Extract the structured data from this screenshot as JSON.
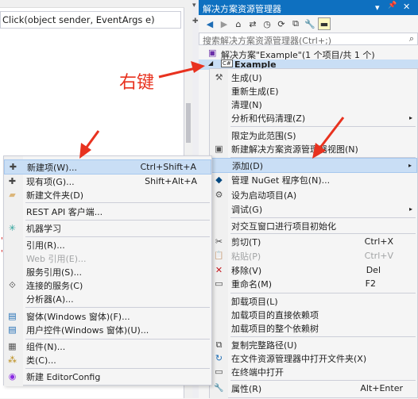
{
  "editor": {
    "signature": "Click(object sender, EventArgs e)",
    "gutter_chars": [
      "'",
      "'",
      "'"
    ]
  },
  "annotation": {
    "text": "右键",
    "color": "#e8321f"
  },
  "solution_explorer": {
    "title": "解决方案资源管理器",
    "title_icons": {
      "dropdown": "▾",
      "pin": "📌",
      "close": "✕"
    },
    "toolbar": {
      "back": "◀",
      "forward": "▶",
      "home": "⌂",
      "sync": "⇄",
      "history": "◷",
      "refresh": "⟳",
      "collapse": "⧉",
      "properties": "🔧",
      "preview": "▬"
    },
    "search_placeholder": "搜索解决方案资源管理器(Ctrl+;)",
    "search_icon": "⌕",
    "solution_node": "解决方案\"Example\"(1 个项目/共 1 个)",
    "project_node": "Example",
    "tree_icons": {
      "solution": "▣",
      "project": "C#"
    }
  },
  "context_menu": {
    "items": [
      {
        "label": "生成(U)",
        "icon": "⚒"
      },
      {
        "label": "重新生成(E)"
      },
      {
        "label": "清理(N)"
      },
      {
        "label": "分析和代码清理(Z)",
        "submenu": "▸"
      },
      {
        "label": "限定为此范围(S)"
      },
      {
        "label": "新建解决方案资源管理器视图(N)",
        "icon": "▣"
      },
      {
        "label": "添加(D)",
        "submenu": "▸",
        "highlighted": true
      },
      {
        "label": "管理 NuGet 程序包(N)...",
        "icon": "◆"
      },
      {
        "label": "设为启动项目(A)",
        "icon": "⚙"
      },
      {
        "label": "调试(G)",
        "submenu": "▸"
      },
      {
        "label": "对交互窗口进行项目初始化"
      },
      {
        "label": "剪切(T)",
        "icon": "✂",
        "shortcut": "Ctrl+X"
      },
      {
        "label": "粘贴(P)",
        "icon": "📋",
        "shortcut": "Ctrl+V",
        "disabled": true
      },
      {
        "label": "移除(V)",
        "icon": "✕",
        "shortcut": "Del"
      },
      {
        "label": "重命名(M)",
        "icon": "▭",
        "shortcut": "F2"
      },
      {
        "label": "卸载项目(L)"
      },
      {
        "label": "加载项目的直接依赖项"
      },
      {
        "label": "加载项目的整个依赖树"
      },
      {
        "label": "复制完整路径(U)",
        "icon": "⧉"
      },
      {
        "label": "在文件资源管理器中打开文件夹(X)",
        "icon": "↻"
      },
      {
        "label": "在终端中打开",
        "icon": "▭"
      },
      {
        "label": "属性(R)",
        "icon": "🔧",
        "shortcut": "Alt+Enter"
      }
    ]
  },
  "add_submenu": {
    "items": [
      {
        "label": "新建项(W)...",
        "icon": "✚",
        "shortcut": "Ctrl+Shift+A",
        "highlighted": true
      },
      {
        "label": "现有项(G)...",
        "icon": "✚",
        "shortcut": "Shift+Alt+A"
      },
      {
        "label": "新建文件夹(D)",
        "icon": "▰"
      },
      {
        "label": "REST API 客户端..."
      },
      {
        "label": "机器学习",
        "icon": "✳"
      },
      {
        "label": "引用(R)..."
      },
      {
        "label": "Web 引用(E)...",
        "disabled": true
      },
      {
        "label": "服务引用(S)..."
      },
      {
        "label": "连接的服务(C)",
        "icon": "⟐"
      },
      {
        "label": "分析器(A)..."
      },
      {
        "label": "窗体(Windows 窗体)(F)...",
        "icon": "▤"
      },
      {
        "label": "用户控件(Windows 窗体)(U)...",
        "icon": "▤"
      },
      {
        "label": "组件(N)...",
        "icon": "▦"
      },
      {
        "label": "类(C)...",
        "icon": "⁂"
      },
      {
        "label": "新建 EditorConfig",
        "icon": "◉"
      }
    ]
  },
  "colors": {
    "menu_highlight": "#c9def5",
    "accent": "#0e70c0",
    "arrow": "#e8321f"
  }
}
